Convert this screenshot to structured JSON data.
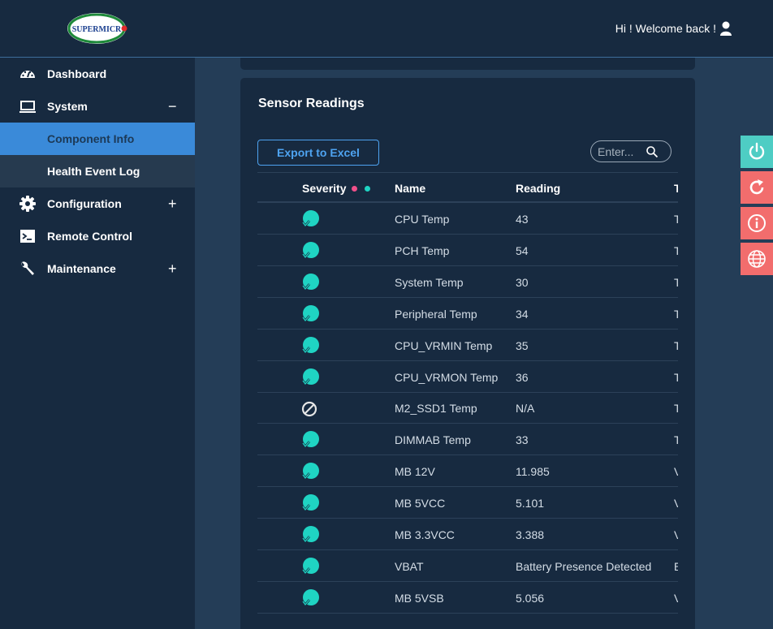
{
  "brand": {
    "logo_text": "SUPERMICRO"
  },
  "header": {
    "welcome": "Hi ! Welcome back !"
  },
  "sidebar": {
    "dashboard": "Dashboard",
    "system": "System",
    "system_toggle": "−",
    "component_info": "Component Info",
    "health_event_log": "Health Event Log",
    "configuration": "Configuration",
    "configuration_toggle": "+",
    "remote_control": "Remote Control",
    "maintenance": "Maintenance",
    "maintenance_toggle": "+"
  },
  "panel": {
    "title": "Sensor Readings",
    "export_label": "Export to Excel",
    "search_placeholder": "Enter..."
  },
  "table": {
    "headers": {
      "severity": "Severity",
      "name": "Name",
      "reading": "Reading",
      "type_partial": "T"
    },
    "rows": [
      {
        "name": "CPU Temp",
        "reading": "43",
        "type": "T",
        "status": "ok"
      },
      {
        "name": "PCH Temp",
        "reading": "54",
        "type": "T",
        "status": "ok"
      },
      {
        "name": "System Temp",
        "reading": "30",
        "type": "T",
        "status": "ok"
      },
      {
        "name": "Peripheral Temp",
        "reading": "34",
        "type": "T",
        "status": "ok"
      },
      {
        "name": "CPU_VRMIN Temp",
        "reading": "35",
        "type": "T",
        "status": "ok"
      },
      {
        "name": "CPU_VRMON Temp",
        "reading": "36",
        "type": "T",
        "status": "ok"
      },
      {
        "name": "M2_SSD1 Temp",
        "reading": "N/A",
        "type": "T",
        "status": "na"
      },
      {
        "name": "DIMMAB Temp",
        "reading": "33",
        "type": "T",
        "status": "ok"
      },
      {
        "name": "MB 12V",
        "reading": "11.985",
        "type": "V",
        "status": "ok"
      },
      {
        "name": "MB 5VCC",
        "reading": "5.101",
        "type": "V",
        "status": "ok"
      },
      {
        "name": "MB 3.3VCC",
        "reading": "3.388",
        "type": "V",
        "status": "ok"
      },
      {
        "name": "VBAT",
        "reading": "Battery Presence Detected",
        "type": "E",
        "status": "ok"
      },
      {
        "name": "MB 5VSB",
        "reading": "5.056",
        "type": "V",
        "status": "ok"
      }
    ]
  },
  "colors": {
    "ok": "#1fd4c3",
    "critical": "#f0508a",
    "accent": "#3a8ad9",
    "tool_green": "#4ecdc4",
    "tool_red": "#f26d6d"
  },
  "tools": [
    "power-icon",
    "refresh-icon",
    "info-icon",
    "language-icon"
  ]
}
